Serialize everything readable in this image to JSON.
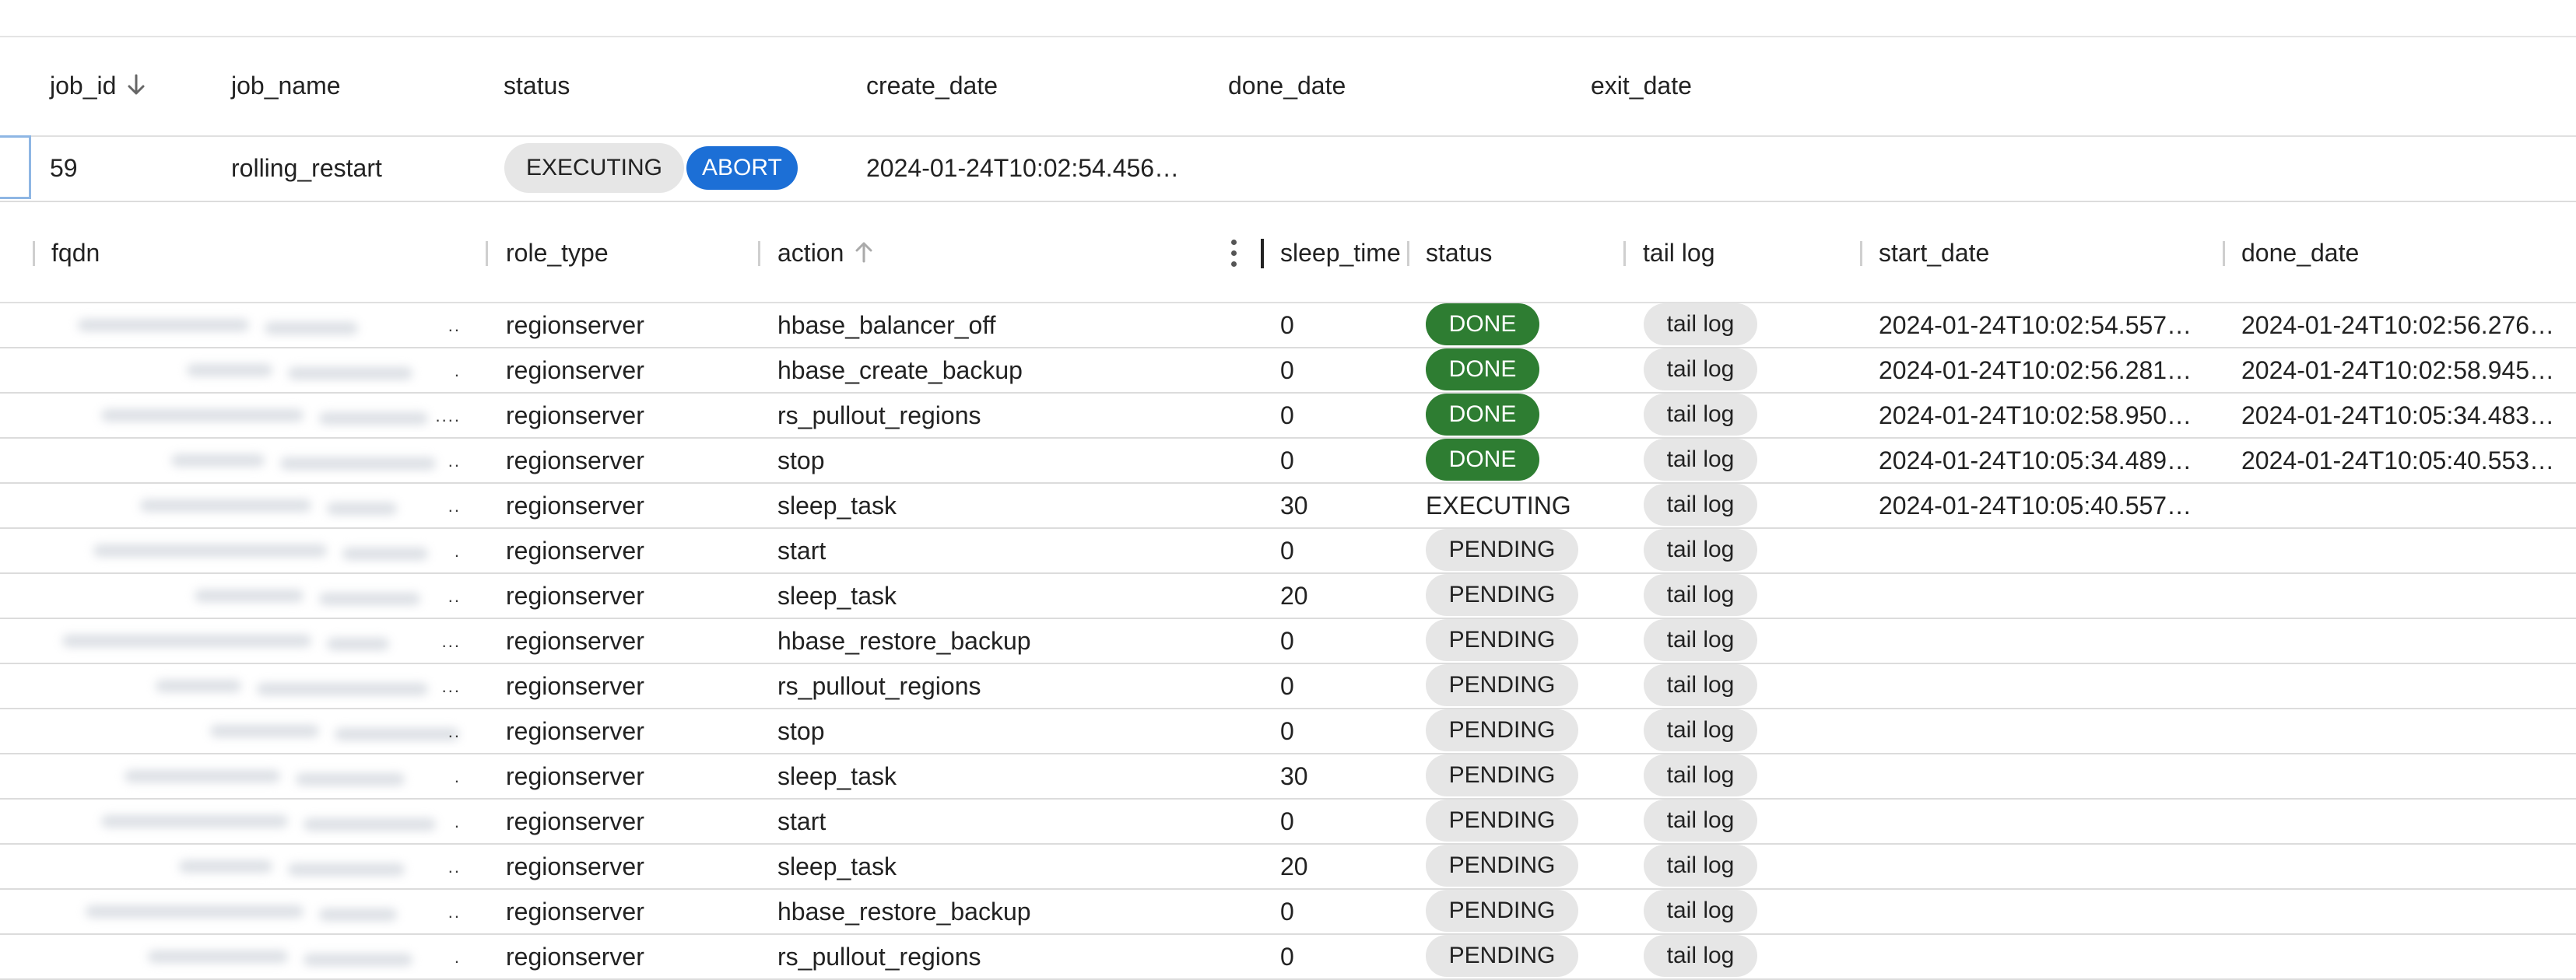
{
  "jobs_table": {
    "columns": [
      "job_id",
      "job_name",
      "status",
      "create_date",
      "done_date",
      "exit_date"
    ],
    "row": {
      "job_id": "59",
      "job_name": "rolling_restart",
      "status": "EXECUTING",
      "action": "ABORT",
      "create_date": "2024-01-24T10:02:54.456…",
      "done_date": "",
      "exit_date": ""
    }
  },
  "tasks_table": {
    "columns": [
      "fqdn",
      "role_type",
      "action",
      "sleep_time",
      "status",
      "tail log",
      "start_date",
      "done_date"
    ],
    "rows": [
      {
        "fqdn_tail": "..",
        "role_type": "regionserver",
        "action": "hbase_balancer_off",
        "sleep_time": "0",
        "status": "DONE",
        "tail": "tail log",
        "start_date": "2024-01-24T10:02:54.557…",
        "done_date": "2024-01-24T10:02:56.276…"
      },
      {
        "fqdn_tail": ".",
        "role_type": "regionserver",
        "action": "hbase_create_backup",
        "sleep_time": "0",
        "status": "DONE",
        "tail": "tail log",
        "start_date": "2024-01-24T10:02:56.281…",
        "done_date": "2024-01-24T10:02:58.945…"
      },
      {
        "fqdn_tail": "....",
        "role_type": "regionserver",
        "action": "rs_pullout_regions",
        "sleep_time": "0",
        "status": "DONE",
        "tail": "tail log",
        "start_date": "2024-01-24T10:02:58.950…",
        "done_date": "2024-01-24T10:05:34.483…"
      },
      {
        "fqdn_tail": "..",
        "role_type": "regionserver",
        "action": "stop",
        "sleep_time": "0",
        "status": "DONE",
        "tail": "tail log",
        "start_date": "2024-01-24T10:05:34.489…",
        "done_date": "2024-01-24T10:05:40.553…"
      },
      {
        "fqdn_tail": "..",
        "role_type": "regionserver",
        "action": "sleep_task",
        "sleep_time": "30",
        "status": "EXECUTING",
        "tail": "tail log",
        "start_date": "2024-01-24T10:05:40.557…",
        "done_date": ""
      },
      {
        "fqdn_tail": ".",
        "role_type": "regionserver",
        "action": "start",
        "sleep_time": "0",
        "status": "PENDING",
        "tail": "tail log",
        "start_date": "",
        "done_date": ""
      },
      {
        "fqdn_tail": "..",
        "role_type": "regionserver",
        "action": "sleep_task",
        "sleep_time": "20",
        "status": "PENDING",
        "tail": "tail log",
        "start_date": "",
        "done_date": ""
      },
      {
        "fqdn_tail": "...",
        "role_type": "regionserver",
        "action": "hbase_restore_backup",
        "sleep_time": "0",
        "status": "PENDING",
        "tail": "tail log",
        "start_date": "",
        "done_date": ""
      },
      {
        "fqdn_tail": "...",
        "role_type": "regionserver",
        "action": "rs_pullout_regions",
        "sleep_time": "0",
        "status": "PENDING",
        "tail": "tail log",
        "start_date": "",
        "done_date": ""
      },
      {
        "fqdn_tail": "..",
        "role_type": "regionserver",
        "action": "stop",
        "sleep_time": "0",
        "status": "PENDING",
        "tail": "tail log",
        "start_date": "",
        "done_date": ""
      },
      {
        "fqdn_tail": ".",
        "role_type": "regionserver",
        "action": "sleep_task",
        "sleep_time": "30",
        "status": "PENDING",
        "tail": "tail log",
        "start_date": "",
        "done_date": ""
      },
      {
        "fqdn_tail": ".",
        "role_type": "regionserver",
        "action": "start",
        "sleep_time": "0",
        "status": "PENDING",
        "tail": "tail log",
        "start_date": "",
        "done_date": ""
      },
      {
        "fqdn_tail": "..",
        "role_type": "regionserver",
        "action": "sleep_task",
        "sleep_time": "20",
        "status": "PENDING",
        "tail": "tail log",
        "start_date": "",
        "done_date": ""
      },
      {
        "fqdn_tail": "..",
        "role_type": "regionserver",
        "action": "hbase_restore_backup",
        "sleep_time": "0",
        "status": "PENDING",
        "tail": "tail log",
        "start_date": "",
        "done_date": ""
      },
      {
        "fqdn_tail": ".",
        "role_type": "regionserver",
        "action": "rs_pullout_regions",
        "sleep_time": "0",
        "status": "PENDING",
        "tail": "tail log",
        "start_date": "",
        "done_date": ""
      }
    ]
  },
  "icons": {
    "sort_desc": "arrow-down-icon",
    "sort_asc": "arrow-up-icon",
    "column_menu": "kebab-menu-icon"
  },
  "colors": {
    "done": "#2e7d32",
    "abort": "#1c6fd6",
    "chip_gray": "#e6e6e6",
    "row_border": "#dcdcdc"
  }
}
